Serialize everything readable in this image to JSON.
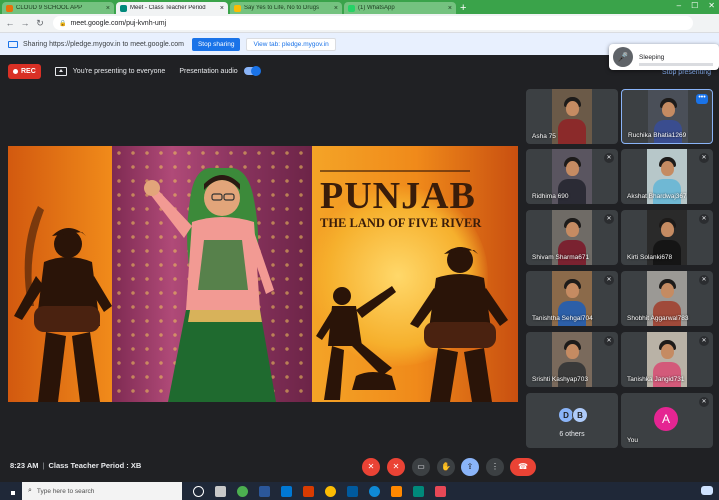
{
  "browser": {
    "tabs": [
      {
        "label": "CLOUD 9 SCHOOL APP",
        "favicon_color": "#e8710a",
        "active": false
      },
      {
        "label": "Meet - Class Teacher Period",
        "favicon_color": "#00897b",
        "active": true
      },
      {
        "label": "Say Yes to Life, No to Drugs",
        "favicon_color": "#fbbc04",
        "active": false
      },
      {
        "label": "(1) WhatsApp",
        "favicon_color": "#25d366",
        "active": false
      }
    ],
    "new_tab_label": "+",
    "url": "meet.google.com/puj-kvnh-umj",
    "accent_color": "#3aa34a"
  },
  "share_bar": {
    "message": "Sharing https://pledge.mygov.in to meet.google.com",
    "stop_label": "Stop sharing",
    "view_tab_label": "View tab: pledge.mygov.in"
  },
  "meet_header": {
    "rec_label": "REC",
    "presenting_text": "You're presenting to everyone",
    "audio_label": "Presentation audio",
    "stop_presenting_label": "Stop presenting"
  },
  "sleep_widget": {
    "status": "Sleeping"
  },
  "presentation": {
    "title": "PUNJAB",
    "subtitle": "THE LAND OF FIVE RIVER"
  },
  "participants": [
    {
      "name": "Asha 75",
      "muted": false,
      "shirt": "#8b2a2a",
      "bg": "#6b5a48"
    },
    {
      "name": "Ruchika Bhatia1269",
      "muted": false,
      "pinned_menu": true,
      "shirt": "#3a4d8f",
      "bg": "#4a4f58"
    },
    {
      "name": "Ridhima 690",
      "muted": true,
      "shirt": "#2b2b35",
      "bg": "#5a5560"
    },
    {
      "name": "Akshat Bhardwaj367",
      "muted": true,
      "shirt": "#6fb8d4",
      "bg": "#b7c7c9"
    },
    {
      "name": "Shivam Sharma671",
      "muted": true,
      "shirt": "#7a2230",
      "bg": "#6f6b66"
    },
    {
      "name": "Kirti Solanki678",
      "muted": true,
      "shirt": "#151515",
      "bg": "#2a2a2a"
    },
    {
      "name": "Tanishtha Sehgal704",
      "muted": true,
      "shirt": "#2c5fa8",
      "bg": "#8b6a4a"
    },
    {
      "name": "Shobhit Aggarwal783",
      "muted": true,
      "shirt": "#a04a3a",
      "bg": "#9b9995"
    },
    {
      "name": "Srishti Kashyap703",
      "muted": true,
      "shirt": "#3a3a3a",
      "bg": "#7a6a5c"
    },
    {
      "name": "Tanishka Jangid731",
      "muted": true,
      "shirt": "#d35a7a",
      "bg": "#b9b2a6"
    }
  ],
  "others_tile": {
    "initials": [
      "D",
      "B"
    ],
    "label": "6 others"
  },
  "self_tile": {
    "initial": "A",
    "label": "You"
  },
  "meeting": {
    "time": "8:23 AM",
    "separator": "|",
    "title": "Class Teacher Period : XB"
  },
  "controls": [
    {
      "name": "mic-toggle-button",
      "glyph": "✕",
      "style": "red"
    },
    {
      "name": "camera-toggle-button",
      "glyph": "✕",
      "style": "red"
    },
    {
      "name": "captions-button",
      "glyph": "▭",
      "style": "dark"
    },
    {
      "name": "raise-hand-button",
      "glyph": "✋",
      "style": "dark"
    },
    {
      "name": "present-now-button",
      "glyph": "⇪",
      "style": "blue"
    },
    {
      "name": "more-options-button",
      "glyph": "⋮",
      "style": "dark"
    },
    {
      "name": "leave-call-button",
      "glyph": "☎",
      "style": "leave"
    }
  ],
  "taskbar": {
    "search_placeholder": "Type here to search",
    "apps": [
      {
        "name": "cortana-icon",
        "color": "#ffffff",
        "round": true
      },
      {
        "name": "task-view-icon",
        "color": "#c8c8c8",
        "round": false
      },
      {
        "name": "chrome-icon",
        "color": "#4caf50",
        "round": true
      },
      {
        "name": "word-icon",
        "color": "#2b579a",
        "round": false
      },
      {
        "name": "mail-icon",
        "color": "#0078d4",
        "round": false
      },
      {
        "name": "photos-icon",
        "color": "#d83b01",
        "round": false
      },
      {
        "name": "chrome-icon-2",
        "color": "#fbbc04",
        "round": true
      },
      {
        "name": "media-icon",
        "color": "#005a9e",
        "round": false
      },
      {
        "name": "edge-icon",
        "color": "#0f8ad6",
        "round": true
      },
      {
        "name": "vlc-icon",
        "color": "#ff8800",
        "round": false
      },
      {
        "name": "meet-icon",
        "color": "#00897b",
        "round": false
      },
      {
        "name": "store-icon",
        "color": "#e74856",
        "round": false
      }
    ]
  }
}
